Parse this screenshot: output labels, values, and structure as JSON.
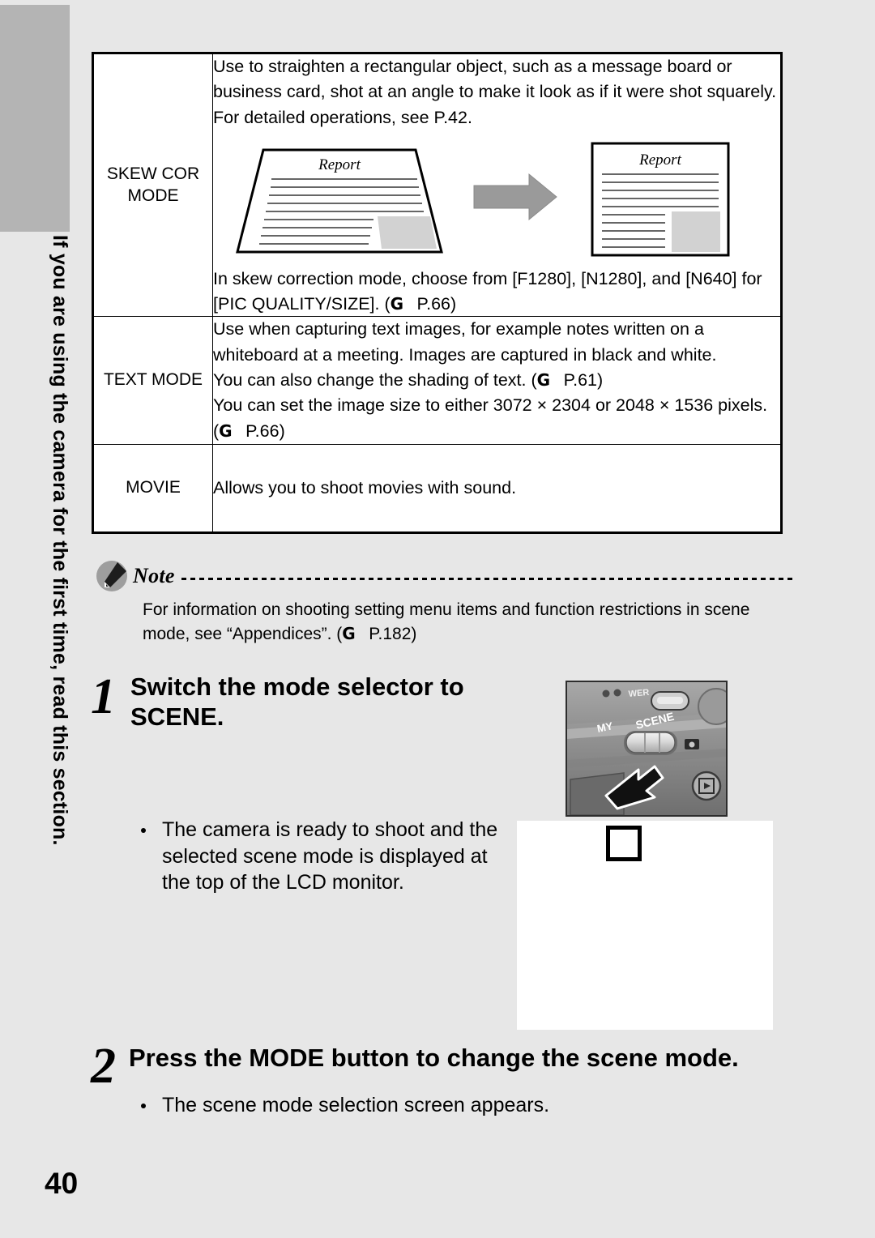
{
  "page": {
    "number": "40",
    "side_tab_text": "If you are using the camera for the first time, read this section."
  },
  "mode_table": {
    "rows": [
      {
        "label": "SKEW COR\nMODE",
        "label_line1": "SKEW COR",
        "label_line2": "MODE",
        "paragraph1": "Use to straighten a rectangular object, such as a message board or business card, shot at an angle to make it look as if it were shot squarely. For detailed operations, see P.42.",
        "figure": {
          "name": "skew-correction-illustration",
          "source_label": "Report",
          "result_label": "Report",
          "arrow": "right-arrow"
        },
        "paragraph2_prefix": "In skew correction mode, choose from [F1280], [N1280], and [N640] for [PIC QUALITY/SIZE]. (",
        "paragraph2_ref_icon": "G",
        "paragraph2_ref_page": "P.66",
        "paragraph2_suffix": ")"
      },
      {
        "label_line1": "TEXT MODE",
        "label_line2": "",
        "paragraph1": "Use when capturing text images, for example notes written on a whiteboard at a meeting. Images are captured in black and white.",
        "paragraph2_prefix": "You can also change the shading of text. (",
        "paragraph2_ref_icon": "G",
        "paragraph2_ref_page": "P.61",
        "paragraph2_suffix": ")",
        "paragraph3_prefix": "You can set the image size to either 3072 × 2304 or 2048 × 1536 pixels. (",
        "paragraph3_ref_icon": "G",
        "paragraph3_ref_page": "P.66",
        "paragraph3_suffix": ")"
      },
      {
        "label_line1": "MOVIE",
        "label_line2": "",
        "paragraph1": "Allows you to shoot movies with sound."
      }
    ]
  },
  "note": {
    "icon": "note-pencil-icon",
    "heading": "Note",
    "body_prefix": "For information on shooting setting menu items and function restrictions in scene mode, see “Appendices”. (",
    "body_ref_icon": "G",
    "body_ref_page": "P.182",
    "body_suffix": ")"
  },
  "steps": [
    {
      "number": "1",
      "title": "Switch the mode selector to SCENE.",
      "bullets": [
        "The camera is ready to shoot and the selected scene mode is displayed at the top of the LCD monitor."
      ],
      "figure": {
        "name": "camera-mode-selector-photo",
        "labels": [
          "POWER",
          "MY",
          "SCENE"
        ],
        "pointer": "black-arrow"
      }
    },
    {
      "number": "2",
      "title": "Press the MODE button to change the scene mode.",
      "bullets": [
        "The scene mode selection screen appears."
      ]
    }
  ],
  "lcd_screenshot": {
    "name": "lcd-monitor-screenshot",
    "caption": ""
  },
  "colors": {
    "page_background": "#e7e7e7",
    "chapter_tab": "#b4b4b4",
    "table_border": "#000000",
    "figure_gray": "#d2d2d2",
    "arrow_gray": "#9a9a9a"
  }
}
